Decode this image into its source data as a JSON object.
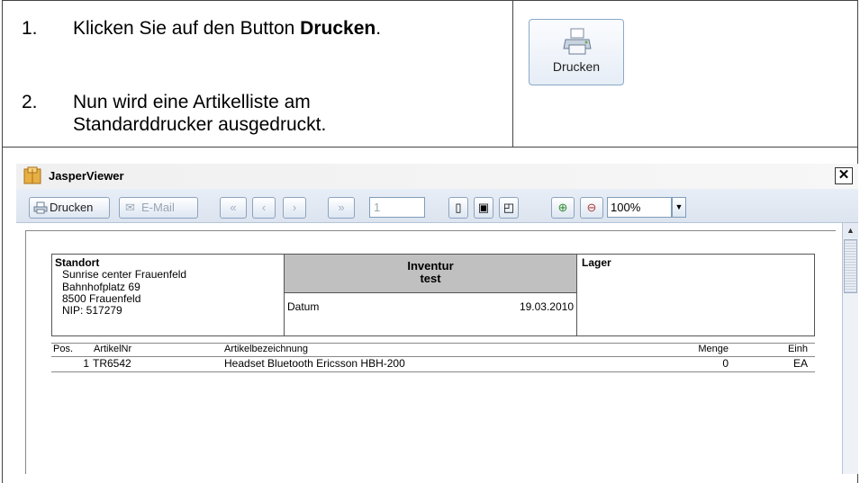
{
  "instructions": {
    "step1_num": "1.",
    "step1_pre": "Klicken Sie auf den Button ",
    "step1_bold": "Drucken",
    "step1_post": ".",
    "step2_num": "2.",
    "step2_line1": "Nun wird eine Artikelliste am",
    "step2_line2": "Standarddrucker ausgedruckt.",
    "print_button_label": "Drucken"
  },
  "viewer": {
    "title": "JasperViewer",
    "toolbar": {
      "print_label": "Drucken",
      "email_label": "E-Mail",
      "page_value": "1",
      "zoom_value": "100%"
    }
  },
  "report": {
    "standort_label": "Standort",
    "address": [
      "Sunrise center Frauenfeld",
      "Bahnhofplatz 69",
      "8500 Frauenfeld",
      "NIP: 517279"
    ],
    "title_line1": "Inventur",
    "title_line2": "test",
    "datum_label": "Datum",
    "datum_value": "19.03.2010",
    "lager_label": "Lager",
    "columns": {
      "pos": "Pos.",
      "artikelnr": "ArtikelNr",
      "bezeichnung": "Artikelbezeichnung",
      "menge": "Menge",
      "einh": "Einh"
    },
    "rows": [
      {
        "pos": "1",
        "artikelnr": "TR6542",
        "bezeichnung": "Headset Bluetooth Ericsson HBH-200",
        "menge": "0",
        "einh": "EA"
      }
    ]
  },
  "colors": {
    "title_bar_accent": "#0a246a",
    "toolbar_bg": "#e0e8f3"
  }
}
